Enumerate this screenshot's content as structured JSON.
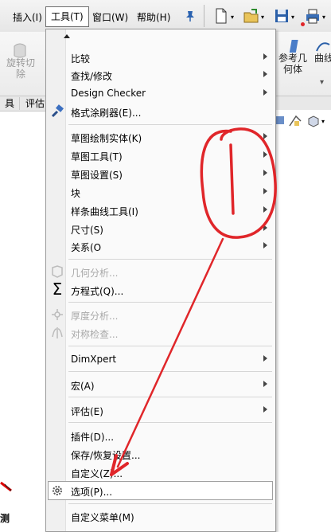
{
  "menubar": {
    "insert": "插入(I)",
    "tools": "工具(T)",
    "window": "窗口(W)",
    "help": "帮助(H)",
    "pin_icon": "pin-icon"
  },
  "ribbon": {
    "rotate_cut_line1": "旋转切",
    "rotate_cut_line2": "除",
    "ref_geometry_line1": "参考几",
    "ref_geometry_line2": "何体",
    "curves": "曲线"
  },
  "tabs": [
    "具",
    "评估"
  ],
  "menu": {
    "items": [
      {
        "label": "比较",
        "arrow": true
      },
      {
        "label": "查找/修改",
        "arrow": true
      },
      {
        "label": "Design Checker",
        "arrow": true
      },
      {
        "label": "格式涂刷器(E)...",
        "arrow": false,
        "icon": "format-painter-icon"
      },
      {
        "label": "草图绘制实体(K)",
        "arrow": true
      },
      {
        "label": "草图工具(T)",
        "arrow": true
      },
      {
        "label": "草图设置(S)",
        "arrow": true
      },
      {
        "label": "块",
        "arrow": true
      },
      {
        "label": "样条曲线工具(I)",
        "arrow": true
      },
      {
        "label": "尺寸(S)",
        "arrow": true
      },
      {
        "label": "关系(O",
        "arrow": true
      },
      {
        "label": "几何分析...",
        "arrow": false,
        "disabled": true,
        "icon": "geometry-analysis-icon"
      },
      {
        "label": "方程式(Q)...",
        "arrow": false,
        "icon": "sigma-icon"
      },
      {
        "label": "厚度分析...",
        "arrow": false,
        "disabled": true,
        "icon": "thickness-analysis-icon"
      },
      {
        "label": "对称检查...",
        "arrow": false,
        "disabled": true,
        "icon": "symmetry-check-icon"
      },
      {
        "label": "DimXpert",
        "arrow": true
      },
      {
        "label": "宏(A)",
        "arrow": true
      },
      {
        "label": "评估(E)",
        "arrow": true
      },
      {
        "label": "插件(D)...",
        "arrow": false
      },
      {
        "label": "保存/恢复设置...",
        "arrow": false
      },
      {
        "label": "自定义(Z)...",
        "arrow": false
      },
      {
        "label": "选项(P)...",
        "arrow": false,
        "icon": "gear-icon",
        "highlighted": true
      },
      {
        "label": "自定义菜单(M)",
        "arrow": false
      }
    ]
  },
  "colors": {
    "annotation": "#e0262a",
    "menu_bg": "#fafafa"
  },
  "left_edge": {
    "fragment": "测"
  }
}
